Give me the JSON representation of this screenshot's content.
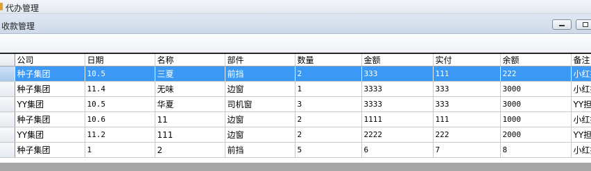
{
  "window": {
    "outer_title": "代办管理",
    "inner_title": "收款管理"
  },
  "grid": {
    "columns": [
      "公司",
      "日期",
      "名称",
      "部件",
      "数量",
      "金额",
      "实付",
      "余额",
      "备注"
    ],
    "rows": [
      {
        "company": "种子集团",
        "date": "10.5",
        "name": "三夏",
        "part": "前挡",
        "qty": "2",
        "amount": "333",
        "paid": "111",
        "balance": "222",
        "remark": "小红括"
      },
      {
        "company": "种子集团",
        "date": "11.4",
        "name": "无味",
        "part": "边窗",
        "qty": "1",
        "amount": "3333",
        "paid": "333",
        "balance": "3000",
        "remark": "小红括"
      },
      {
        "company": "YY集团",
        "date": "10.5",
        "name": "华夏",
        "part": "司机窗",
        "qty": "3",
        "amount": "3333",
        "paid": "333",
        "balance": "3000",
        "remark": "YY担仟"
      },
      {
        "company": "种子集团",
        "date": "10.6",
        "name": "11",
        "part": "边窗",
        "qty": "2",
        "amount": "1111",
        "paid": "111",
        "balance": "1000",
        "remark": "小红括"
      },
      {
        "company": "YY集团",
        "date": "11.2",
        "name": "111",
        "part": "边窗",
        "qty": "2",
        "amount": "2222",
        "paid": "222",
        "balance": "2000",
        "remark": "YY担仟"
      },
      {
        "company": "种子集团",
        "date": "1",
        "name": "2",
        "part": "前挡",
        "qty": "5",
        "amount": "6",
        "paid": "7",
        "balance": "8",
        "remark": "小红括"
      }
    ],
    "selected_row_index": 0,
    "selection_color": "#3b99f5"
  }
}
